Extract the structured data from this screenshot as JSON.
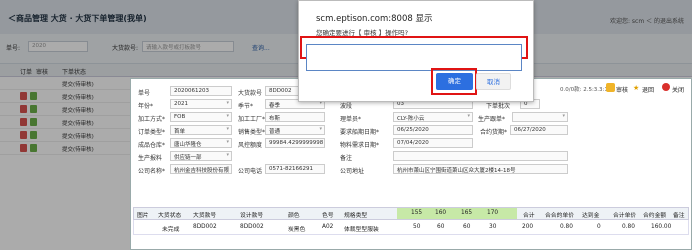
{
  "page": {
    "title": "＜商品管理 大货 · 大货下单管理(我单)",
    "user": "欢迎您: scm  ＜ 的退出系统"
  },
  "search": {
    "order_label": "单号:",
    "order_value": "2020",
    "style_label": "大货款号:",
    "style_placeholder": "请输入款号或打板款号",
    "query_button": "查询..."
  },
  "grid": {
    "headers": [
      "订单",
      "审核",
      "下单状态"
    ],
    "status_values": [
      "提交(待审核)",
      "提交(待审核)",
      "提交(待审核)",
      "提交(待审核)",
      "提交(待审核)",
      "提交(待审核)"
    ]
  },
  "panel": {
    "toolbar": {
      "hint": "0.0/0款: 2.5:3.3:1",
      "audit_label": "审核",
      "back_label": "退回",
      "close_label": "关闭"
    },
    "fields": {
      "order_no_label": "单号",
      "order_no": "2020061203",
      "style_no_label": "大货款号",
      "style_no": "8DD002",
      "design_no_label": "设计款号",
      "design_no": "8DD002",
      "band_label": "波段",
      "band": "03",
      "batch_label": "下单批次",
      "batch": "0",
      "year_label": "年份*",
      "year": "2021",
      "season_label": "季节*",
      "season": "春季",
      "process_label": "加工方式*",
      "process": "FOB",
      "factory_label": "加工工厂*",
      "factory": "布斯",
      "mgr_label": "理单员*",
      "mgr": "CLY-陈小云",
      "prod_label": "生产跟单*",
      "prod": "",
      "type_label": "订单类型*",
      "type": "首单",
      "sale_label": "销售类型*",
      "sale": "普通",
      "req_date_label": "要求船期日期*",
      "req_date": "06/25/2020",
      "contract_label": "合约货期*",
      "contract": "06/27/2020",
      "wh_label": "成品仓库*",
      "wh": "唐山华隆仓",
      "risk_label": "风控额度",
      "risk": "99984.4299999998",
      "mat_label": "物料需求日期*",
      "mat": "07/04/2020",
      "supplier_label": "生产报料",
      "supplier": "供应链一部",
      "remark_label": "备注",
      "remark": "",
      "company_label": "公司名称*",
      "company": "杭州金吉科技股份有限",
      "phone_label": "公司电话",
      "phone": "0571-82166291",
      "addr_label": "公司地址",
      "addr": "杭州市萧山区宁围街道萧山区众大厦2楼14-18号"
    },
    "table": {
      "headers": [
        "图片",
        "大货状态",
        "大货款号",
        "设计款号",
        "颜色",
        "色号",
        "规格类型",
        "155",
        "160",
        "165",
        "170",
        "合计",
        "合合的单价",
        "达到金",
        "合计单价",
        "合约金额",
        "备注"
      ],
      "row": [
        "",
        "未完成",
        "8DD002",
        "8DD002",
        "炭黑色",
        "A02",
        "体裁型型服装",
        "50",
        "60",
        "60",
        "30",
        "200",
        "0.80",
        "0",
        "0.80",
        "160.00",
        ""
      ]
    }
  },
  "dialog": {
    "title": "scm.eptison.com:8008 显示",
    "message": "您确定要进行【 审核 】操作吗?",
    "input_value": "",
    "ok_label": "确定",
    "cancel_label": "取消"
  }
}
